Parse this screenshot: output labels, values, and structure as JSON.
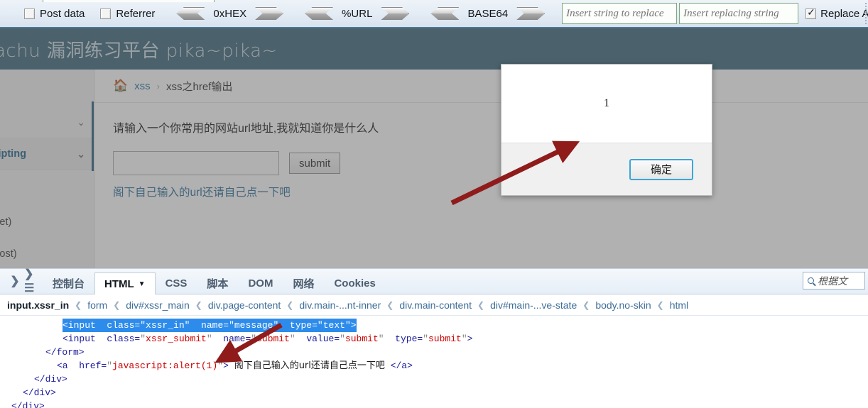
{
  "toolbar": {
    "checkboxes": [
      {
        "label": "Post data",
        "checked": false
      },
      {
        "label": "Referrer",
        "checked": false
      }
    ],
    "encoders": [
      {
        "label": "0xHEX"
      },
      {
        "label": "%URL"
      },
      {
        "label": "BASE64"
      }
    ],
    "replace_source_placeholder": "Insert string to replace",
    "replace_target_placeholder": "Insert replacing string",
    "replace_all": {
      "label": "Replace All",
      "checked": true
    }
  },
  "page": {
    "header_title": "achu 漏洞练习平台 pika~pika~",
    "sidebar": {
      "collapsed_row": "",
      "active_row": "e Scripting",
      "sub_items": [
        "ss(get)",
        "ss(post)"
      ]
    },
    "breadcrumb": {
      "home_icon": "home-icon",
      "link": "xss",
      "separator": "›",
      "current": "xss之href输出"
    },
    "prompt": "请输入一个你常用的网站url地址,我就知道你是什么人",
    "input_value": "",
    "submit_label": "submit",
    "hint_link": "阁下自己输入的url还请自己点一下吧"
  },
  "alert": {
    "message": "1",
    "ok_label": "确定"
  },
  "devtools": {
    "icons": [
      "chevron-right-icon",
      "list-icon"
    ],
    "tabs": [
      {
        "label": "控制台",
        "active": false
      },
      {
        "label": "HTML",
        "active": true,
        "caret": "▼"
      },
      {
        "label": "CSS",
        "active": false
      },
      {
        "label": "脚本",
        "active": false
      },
      {
        "label": "DOM",
        "active": false
      },
      {
        "label": "网络",
        "active": false
      },
      {
        "label": "Cookies",
        "active": false
      }
    ],
    "search_placeholder": "根据文",
    "breadcrumb": [
      "input.xssr_in",
      "form",
      "div#xssr_main",
      "div.page-content",
      "div.main-...nt-inner",
      "div.main-content",
      "div#main-...ve-state",
      "body.no-skin",
      "html"
    ],
    "code_lines": [
      {
        "indent": 11,
        "selected": true,
        "text": "<input  class=\"xssr_in\"  name=\"message\"  type=\"text\">"
      },
      {
        "indent": 11,
        "selected": false,
        "text": "<input  class=\"xssr_submit\"  name=\"submit\"  value=\"submit\"  type=\"submit\">"
      },
      {
        "indent": 8,
        "selected": false,
        "text": "</form>"
      },
      {
        "indent": 10,
        "selected": false,
        "text": "<a  href=\"javascript:alert(1)\"> 阁下自己输入的url还请自己点一下吧 </a>"
      },
      {
        "indent": 6,
        "selected": false,
        "text": "</div>"
      },
      {
        "indent": 4,
        "selected": false,
        "text": "</div>"
      },
      {
        "indent": 2,
        "selected": false,
        "text": "</div>"
      }
    ]
  },
  "colors": {
    "header_bg": "#4c7285",
    "toolbar_accent": "#4d7893",
    "annotation_arrow": "#8f1b1b",
    "selection_blue": "#2d8ceb",
    "attr_value_red": "#cc0000"
  }
}
